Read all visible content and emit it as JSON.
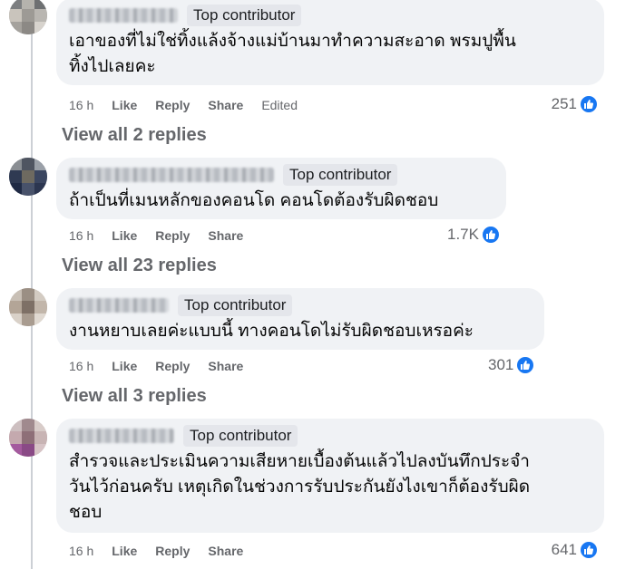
{
  "comments": [
    {
      "badge": "Top contributor",
      "text_lines": [
        "เอาของที่ไม่ใช่ทิ้งแล้งจ้างแม่บ้านมาทำความสะอาด พรมปูพื้น",
        "ทิ้งไปเลยคะ"
      ],
      "time": "16 h",
      "like_label": "Like",
      "reply_label": "Reply",
      "share_label": "Share",
      "edited_label": "Edited",
      "reaction_count": "251",
      "view_replies": "View all 2 replies"
    },
    {
      "badge": "Top contributor",
      "text_lines": [
        "ถ้าเป็นที่เมนหลักของคอนโด คอนโดต้องรับผิดชอบ"
      ],
      "time": "16 h",
      "like_label": "Like",
      "reply_label": "Reply",
      "share_label": "Share",
      "reaction_count": "1.7K",
      "view_replies": "View all 23 replies"
    },
    {
      "badge": "Top contributor",
      "text_lines": [
        "งานหยาบเลยค่ะแบบนี้ ทางคอนโดไม่รับผิดชอบเหรอค่ะ"
      ],
      "time": "16 h",
      "like_label": "Like",
      "reply_label": "Reply",
      "share_label": "Share",
      "reaction_count": "301",
      "view_replies": "View all 3 replies"
    },
    {
      "badge": "Top contributor",
      "text_lines": [
        "สำรวจและประเมินความเสียหายเบื้องต้นแล้วไปลงบันทึกประจำ",
        "วันไว้ก่อนครับ เหตุเกิดในช่วงการรับประกันยังไงเขาก็ต้องรับผิด",
        "ชอบ"
      ],
      "time": "16 h",
      "like_label": "Like",
      "reply_label": "Reply",
      "share_label": "Share",
      "reaction_count": "641"
    }
  ],
  "icons": {
    "reaction": "like-thumb-icon",
    "avatar": "blurred-avatar"
  },
  "colors": {
    "bubble": "#f0f2f5",
    "badge": "#e4e6eb",
    "like_blue": "#1877f2",
    "meta_gray": "#65676b"
  }
}
